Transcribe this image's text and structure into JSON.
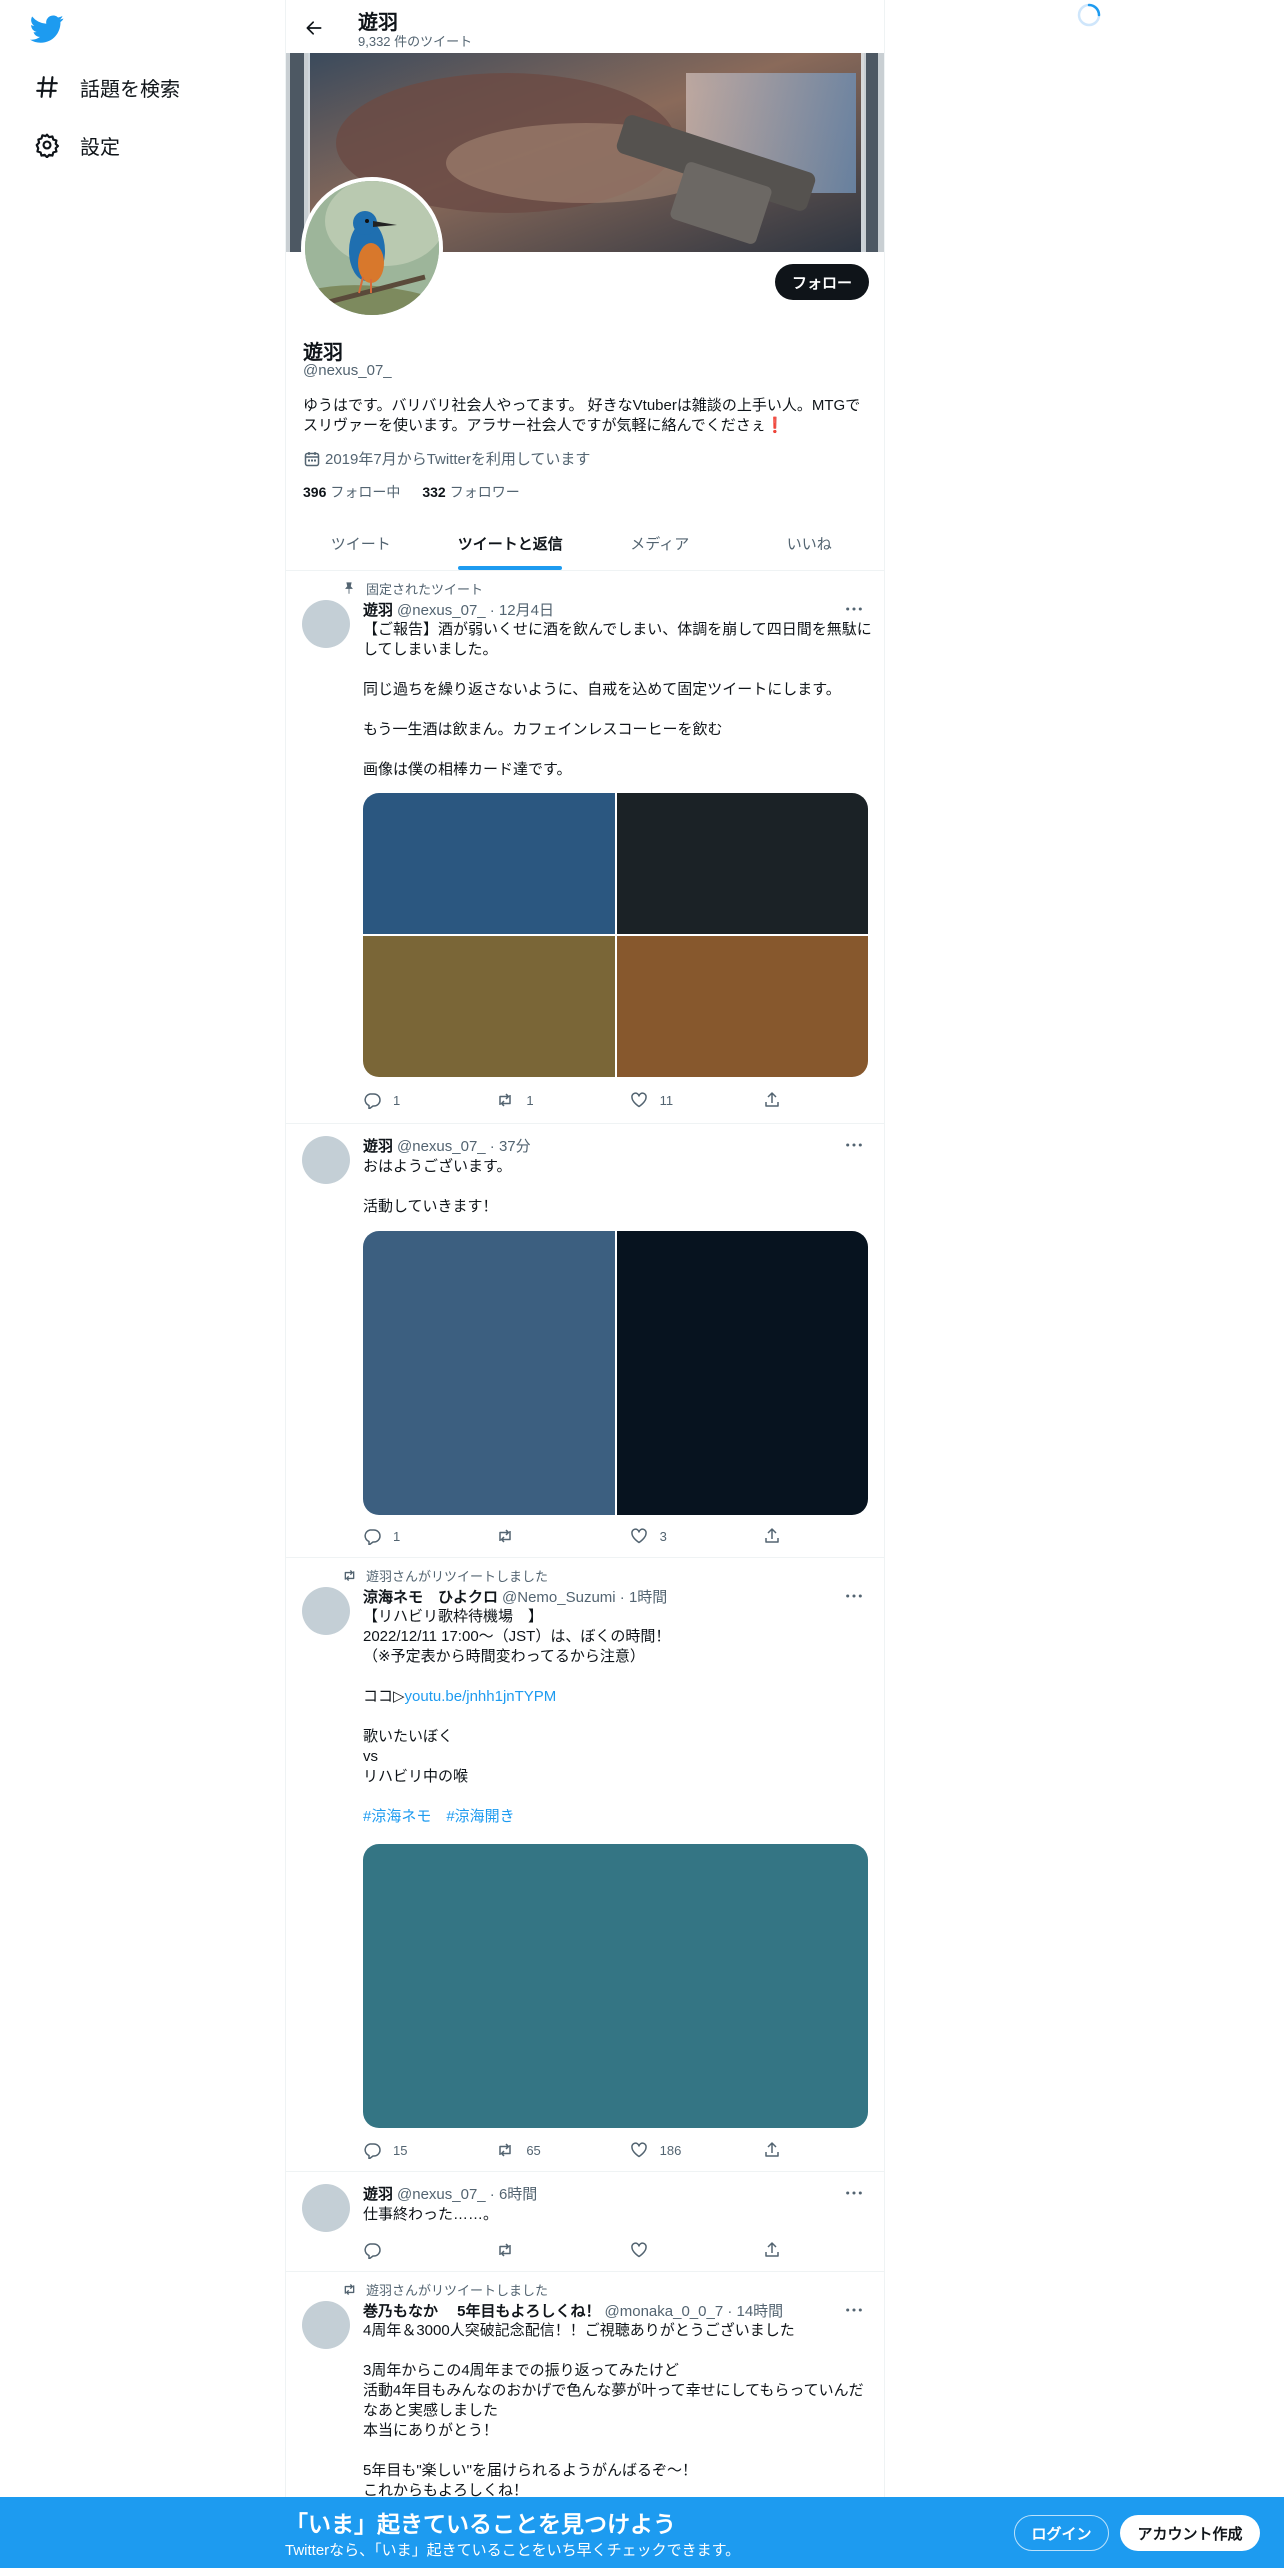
{
  "nav": {
    "logo_icon": "twitter-bird-icon",
    "items": [
      {
        "label": "話題を検索",
        "icon": "hashtag-icon"
      },
      {
        "label": "設定",
        "icon": "gear-icon"
      }
    ]
  },
  "header": {
    "title": "遊羽",
    "subtitle": "9,332 件のツイート"
  },
  "profile": {
    "name": "遊羽",
    "handle": "@nexus_07_",
    "bio": "ゆうはです。バリバリ社会人やってます。 好きなVtuberは雑談の上手い人。MTGでスリヴァーを使います。アラサー社会人ですが気軽に絡んでくださぇ❗",
    "joined": "2019年7月からTwitterを利用しています",
    "following_count": "396",
    "following_label": "フォロー中",
    "followers_count": "332",
    "followers_label": "フォロワー",
    "follow_button": "フォロー"
  },
  "tabs": [
    {
      "label": "ツイート",
      "active": false
    },
    {
      "label": "ツイートと返信",
      "active": true
    },
    {
      "label": "メディア",
      "active": false
    },
    {
      "label": "いいね",
      "active": false
    }
  ],
  "tweets": [
    {
      "context": "固定されたツイート",
      "context_icon": "pin-icon",
      "name": "遊羽",
      "meta": "@nexus_07_ · 12月4日",
      "body": "【ご報告】酒が弱いくせに酒を飲んでしまい、体調を崩して四日間を無駄にしてしまいました。\n\n同じ過ちを繰り返さないように、自戒を込めて固定ツイートにします。\n\nもう一生酒は飲まん。カフェインレスコーヒーを飲む\n\n画像は僕の相棒カード達です。",
      "media_colors": [
        "#2b5780",
        "#1b2226",
        "#7a6637",
        "#87582d"
      ],
      "replies": "1",
      "retweets": "1",
      "likes": "11"
    },
    {
      "context": "",
      "name": "遊羽",
      "meta": "@nexus_07_ · 37分",
      "body": "おはようございます。\n\n活動していきます！",
      "media_colors": [
        "#3c5f80",
        "#07131f"
      ],
      "replies": "1",
      "retweets": "",
      "likes": "3"
    },
    {
      "context": "遊羽さんがリツイートしました",
      "context_icon": "retweet-icon",
      "name": "涼海ネモ　ひよクロ",
      "meta": "@Nemo_Suzumi · 1時間",
      "body_pre": "【リハビリ歌枠待機場　】\n2022/12/11 17:00～（JST）は、ぼくの時間！\n（※予定表から時間変わってるから注意）\n\nココ▷",
      "link": "youtu.be/jnhh1jnTYPM",
      "body_post": "\n\n歌いたいぼく\nvs\nリハビリ中の喉\n\n",
      "hashtags": "#涼海ネモ　#涼海開き",
      "media_colors": [
        "#347584"
      ],
      "replies": "15",
      "retweets": "65",
      "likes": "186"
    },
    {
      "context": "",
      "name": "遊羽",
      "meta": "@nexus_07_ · 6時間",
      "body": "仕事終わった……。",
      "replies": "",
      "retweets": "",
      "likes": ""
    },
    {
      "context": "遊羽さんがリツイートしました",
      "context_icon": "retweet-icon",
      "name": "巻乃もなか　 5年目もよろしくね！",
      "meta": "@monaka_0_0_7 · 14時間",
      "body": "4周年＆3000人突破記念配信！！ご視聴ありがとうございました\n\n3周年からこの4周年までの振り返ってみたけど\n活動4年目もみんなのおかげで色んな夢が叶って幸せにしてもらっていんだなあと実感しました\n本当にありがとう！\n\n5年目も\"楽しい\"を届けられるようがんばるぞ〜！\nこれからもよろしくね！"
    }
  ],
  "bottom_bar": {
    "title": "「いま」起きていることを見つけよう",
    "subtitle": "Twitterなら、「いま」起きていることをいち早くチェックできます。",
    "login": "ログイン",
    "signup": "アカウント作成"
  }
}
